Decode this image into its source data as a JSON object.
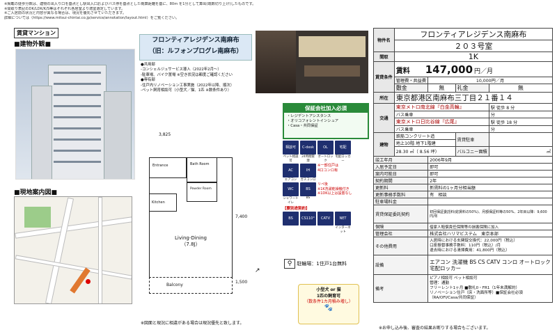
{
  "notes": [
    "※掲載の徒歩分数は、建物の出入り口を基点とし駅出入口およびバス停を基点とした概算距離を基に、80m を1分として算出(端数切り上げ)したものです。",
    "※間取り表記のDK/LDK/K/S等はそれぞれ各居室より適宜選定しています。",
    "※ご入居前の状況と内容が異なる場合は、現況を優先させていただきます。",
    "詳細については（https://www.mitsui-chintai.co.jp/service/annotation/layout.html）をご覧ください。"
  ],
  "badge": "賃貸マンション",
  "exterior_title": "■建物外観■",
  "map_title": "■現地案内図■",
  "property_name_line1": "フロンティアレジデンス南麻布",
  "property_name_line2": "（旧：ルフォンプログレ南麻布）",
  "features": [
    "●共用部",
    "-コンシェルジュサービス導入（2022年2月～）",
    "-駐車場、バイク置場 ※空き状況は都度ご確認ください",
    "●専有部",
    "-住戸内リノベーション工事実施（2022年以降、順次）",
    "-ペット飼育相談可（小型犬／猫、1匹 ※数条件あり）"
  ],
  "guarantee": {
    "title": "保証会社加入必須",
    "items": [
      "・レジデントアシスタンス",
      "・オリコフォレントインシュア",
      "・Casa・共同保証"
    ]
  },
  "icons": [
    {
      "label": "相談可",
      "caption": "ペット相談可"
    },
    {
      "label": "C-desk",
      "caption": "24時間管理"
    },
    {
      "label": "OL",
      "caption": "オートロック"
    },
    {
      "label": "宅配",
      "caption": "宅配ロッカー"
    },
    {
      "label": "AC",
      "caption": "エアコン"
    },
    {
      "label": "IH",
      "caption": "ガスコンロ"
    },
    {
      "label": "WC",
      "caption": "シャワートイレ"
    },
    {
      "label": "BS",
      "caption": "BS"
    },
    {
      "label": "CS",
      "caption": "CS110°"
    },
    {
      "label": "CATV",
      "caption": "CATV"
    },
    {
      "label": "NET",
      "caption": "インターネット"
    }
  ],
  "icon_notes": [
    "※一部住戸は",
    "4口コンロ有",
    "リペ後",
    "※1K洗濯乾燥機付き",
    "※1DK以上は設置なし",
    "【要別途契約】"
  ],
  "bike": "駐輪場：1住戸1台無料",
  "pet": [
    "小型犬 or 猫",
    "1匹の飼育可",
    "（数条件1カ月積み増し）"
  ],
  "floorplan": {
    "width_label": "3,825",
    "height_label": "7,400",
    "bottom_label": "1,500",
    "rooms": {
      "entrance": "Entrance",
      "bath": "Bath Room",
      "kitchen": "Kitchen",
      "living": "Living-Dining",
      "living_size": "（7.8J）",
      "balcony": "Balcony",
      "powder": "Powder Room"
    }
  },
  "footer_note": "※図面と現況に相違がある場合は現況優先と致します。",
  "spec": {
    "name": "フロンティアレジデンス南麻布",
    "room": "２０３号室",
    "layout": "1K",
    "rent_label": "賃料",
    "rent": "147,000",
    "rent_unit": "円／月",
    "mgmt_label": "管理費・共益費",
    "mgmt": "10,000円／月",
    "deposit_label": "敷金",
    "deposit": "無",
    "key_label": "礼金",
    "key": "無",
    "address": "東京都港区南麻布三丁目２１番１４",
    "trains": [
      {
        "line": "東京メトロ南北線『白金高輪』",
        "walk": "駅 徒歩 8 分"
      },
      {
        "line": "東京メトロ日比谷線『広尾』",
        "walk": "駅 徒歩 18 分"
      }
    ],
    "bus": "バス乗車",
    "walk_unit": "分",
    "structure": "鉄筋コンクリート造",
    "floors": "地上10階 地下1階建",
    "parking_label": "賃貸駐車",
    "area": "28.30 ㎡（ 8.56 坪）",
    "balcony_label": "バルコニー面積",
    "balcony": "㎡",
    "rows": [
      {
        "k": "竣工年月",
        "v": "2006年9月"
      },
      {
        "k": "入居予定日",
        "v": "即可"
      },
      {
        "k": "案内可能日",
        "v": "即可"
      },
      {
        "k": "契約期間",
        "v": "2年"
      },
      {
        "k": "更新料",
        "v": "新賃料の1ヶ月分相当額"
      },
      {
        "k": "更新事務手数料",
        "v": "有　相談"
      },
      {
        "k": "駐車場料金",
        "v": ""
      }
    ],
    "guarantee_label": "賃貸保証委託契約",
    "guarantee_text": "初回保証委託料(総賃料の50%)、月額保証料等の50%、2年目以降：9,600円/年",
    "insurance_label": "保険",
    "insurance": "借家人賠償責任保険等の損害保険に加入",
    "agent_label": "管理会社",
    "agent": "株式会社ハリマビステム　東京本部",
    "other_label": "その他費用",
    "other": [
      "入居時における玄関錠交換代：22,000円（税込）",
      "口座振替事務手数料：110円（税込）/月",
      "退去時における清掃費用：41,800円（税込）"
    ],
    "equipment_label": "設備",
    "equipment": "エアコン 洗濯機 BS CS CATV コンロ オートロック 宅配ロッカー",
    "remarks_label": "備考",
    "remarks": [
      "ピアノ相談可 ペット相談可",
      "管理：通勤",
      "フリーレント1ヶ月 ■敷礼0・FR1（1年未満解約）",
      "リノベーション住戸（床・洗面所等）■保証会社必須（RA/OFI/Casa/共同保証）"
    ],
    "apply_note": "※お申し込み後、審査の結果お断りする場合もございます。"
  }
}
